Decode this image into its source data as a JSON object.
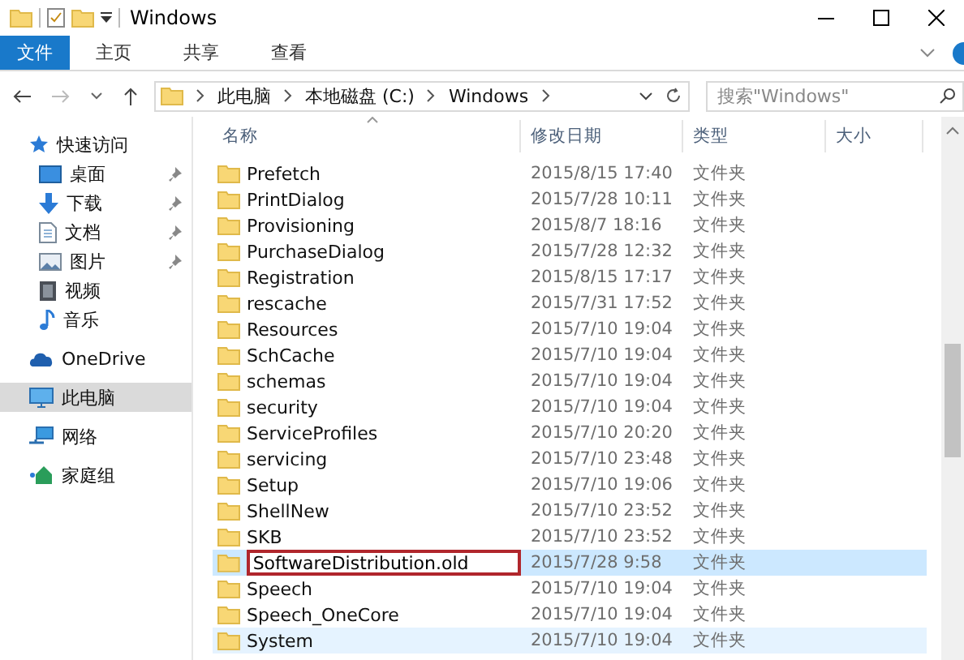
{
  "window": {
    "title": "Windows"
  },
  "ribbon_tabs": [
    {
      "label": "文件",
      "kind": "file",
      "selected": false
    },
    {
      "label": "主页",
      "kind": "tab",
      "selected": false
    },
    {
      "label": "共享",
      "kind": "tab",
      "selected": false
    },
    {
      "label": "查看",
      "kind": "tab",
      "selected": false
    }
  ],
  "address": {
    "path": [
      "此电脑",
      "本地磁盘 (C:)",
      "Windows"
    ]
  },
  "search": {
    "placeholder": "搜索\"Windows\""
  },
  "nav": [
    {
      "label": "快速访问",
      "kind": "star",
      "selected": false,
      "children": [
        {
          "label": "桌面",
          "kind": "desktop",
          "pinned": true,
          "selected": false
        },
        {
          "label": "下载",
          "kind": "download",
          "pinned": true,
          "selected": false
        },
        {
          "label": "文档",
          "kind": "document",
          "pinned": true,
          "selected": false
        },
        {
          "label": "图片",
          "kind": "picture",
          "pinned": true,
          "selected": false
        },
        {
          "label": "视频",
          "kind": "video",
          "pinned": false,
          "selected": false
        },
        {
          "label": "音乐",
          "kind": "music",
          "pinned": false,
          "selected": false
        }
      ]
    },
    {
      "label": "OneDrive",
      "kind": "cloud",
      "selected": false
    },
    {
      "label": "此电脑",
      "kind": "computer",
      "selected": true
    },
    {
      "label": "网络",
      "kind": "network",
      "selected": false
    },
    {
      "label": "家庭组",
      "kind": "homegroup",
      "selected": false
    }
  ],
  "columns": [
    {
      "label": "名称",
      "sorted": true
    },
    {
      "label": "修改日期",
      "sorted": false
    },
    {
      "label": "类型",
      "sorted": false
    },
    {
      "label": "大小",
      "sorted": false
    }
  ],
  "files": [
    {
      "name": "Prefetch",
      "modified": "2015/8/15 17:40",
      "type": "文件夹",
      "selected": false,
      "hovered": false,
      "editing": false
    },
    {
      "name": "PrintDialog",
      "modified": "2015/7/28 10:11",
      "type": "文件夹",
      "selected": false,
      "hovered": false,
      "editing": false
    },
    {
      "name": "Provisioning",
      "modified": "2015/8/7 18:16",
      "type": "文件夹",
      "selected": false,
      "hovered": false,
      "editing": false
    },
    {
      "name": "PurchaseDialog",
      "modified": "2015/7/28 12:32",
      "type": "文件夹",
      "selected": false,
      "hovered": false,
      "editing": false
    },
    {
      "name": "Registration",
      "modified": "2015/8/15 17:17",
      "type": "文件夹",
      "selected": false,
      "hovered": false,
      "editing": false
    },
    {
      "name": "rescache",
      "modified": "2015/7/31 17:52",
      "type": "文件夹",
      "selected": false,
      "hovered": false,
      "editing": false
    },
    {
      "name": "Resources",
      "modified": "2015/7/10 19:04",
      "type": "文件夹",
      "selected": false,
      "hovered": false,
      "editing": false
    },
    {
      "name": "SchCache",
      "modified": "2015/7/10 19:04",
      "type": "文件夹",
      "selected": false,
      "hovered": false,
      "editing": false
    },
    {
      "name": "schemas",
      "modified": "2015/7/10 19:04",
      "type": "文件夹",
      "selected": false,
      "hovered": false,
      "editing": false
    },
    {
      "name": "security",
      "modified": "2015/7/10 19:04",
      "type": "文件夹",
      "selected": false,
      "hovered": false,
      "editing": false
    },
    {
      "name": "ServiceProfiles",
      "modified": "2015/7/10 20:20",
      "type": "文件夹",
      "selected": false,
      "hovered": false,
      "editing": false
    },
    {
      "name": "servicing",
      "modified": "2015/7/10 23:48",
      "type": "文件夹",
      "selected": false,
      "hovered": false,
      "editing": false
    },
    {
      "name": "Setup",
      "modified": "2015/7/10 19:06",
      "type": "文件夹",
      "selected": false,
      "hovered": false,
      "editing": false
    },
    {
      "name": "ShellNew",
      "modified": "2015/7/10 23:52",
      "type": "文件夹",
      "selected": false,
      "hovered": false,
      "editing": false
    },
    {
      "name": "SKB",
      "modified": "2015/7/10 23:52",
      "type": "文件夹",
      "selected": false,
      "hovered": false,
      "editing": false
    },
    {
      "name": "SoftwareDistribution.old",
      "modified": "2015/7/28 9:58",
      "type": "文件夹",
      "selected": true,
      "hovered": false,
      "editing": true
    },
    {
      "name": "Speech",
      "modified": "2015/7/10 19:04",
      "type": "文件夹",
      "selected": false,
      "hovered": false,
      "editing": false
    },
    {
      "name": "Speech_OneCore",
      "modified": "2015/7/10 19:04",
      "type": "文件夹",
      "selected": false,
      "hovered": false,
      "editing": false
    },
    {
      "name": "System",
      "modified": "2015/7/10 19:04",
      "type": "文件夹",
      "selected": false,
      "hovered": true,
      "editing": false
    }
  ]
}
